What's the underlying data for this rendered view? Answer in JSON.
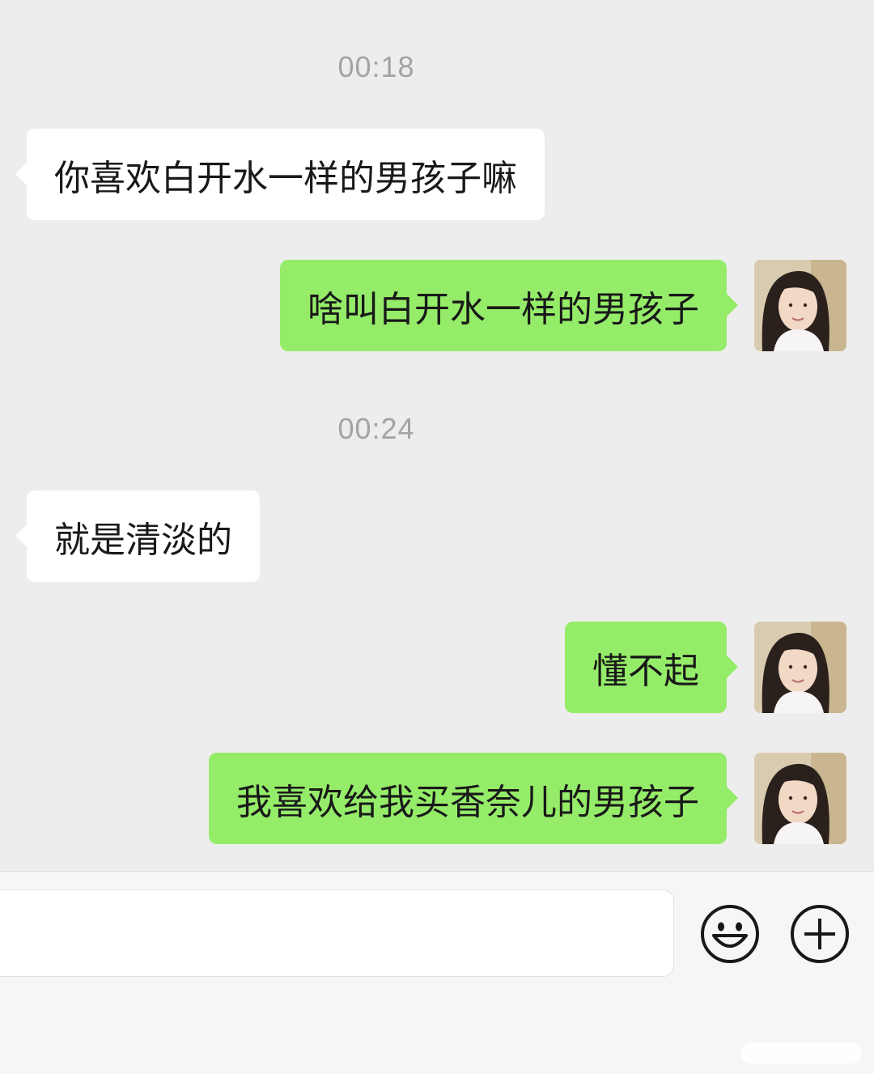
{
  "messages": [
    {
      "type": "timestamp",
      "text": "00:18"
    },
    {
      "type": "incoming",
      "text": "你喜欢白开水一样的男孩子嘛"
    },
    {
      "type": "outgoing",
      "text": "啥叫白开水一样的男孩子"
    },
    {
      "type": "timestamp",
      "text": "00:24"
    },
    {
      "type": "incoming",
      "text": "就是清淡的"
    },
    {
      "type": "outgoing",
      "text": "懂不起"
    },
    {
      "type": "outgoing",
      "text": "我喜欢给我买香奈儿的男孩子"
    }
  ],
  "input_bar": {
    "message_value": "",
    "emoji_button_icon": "smiley-face-icon",
    "more_button_icon": "plus-circle-icon"
  },
  "colors": {
    "background": "#ededed",
    "incoming_bubble": "#ffffff",
    "outgoing_bubble": "#95ec69",
    "timestamp_text": "#a3a3a3",
    "message_text": "#191919"
  }
}
